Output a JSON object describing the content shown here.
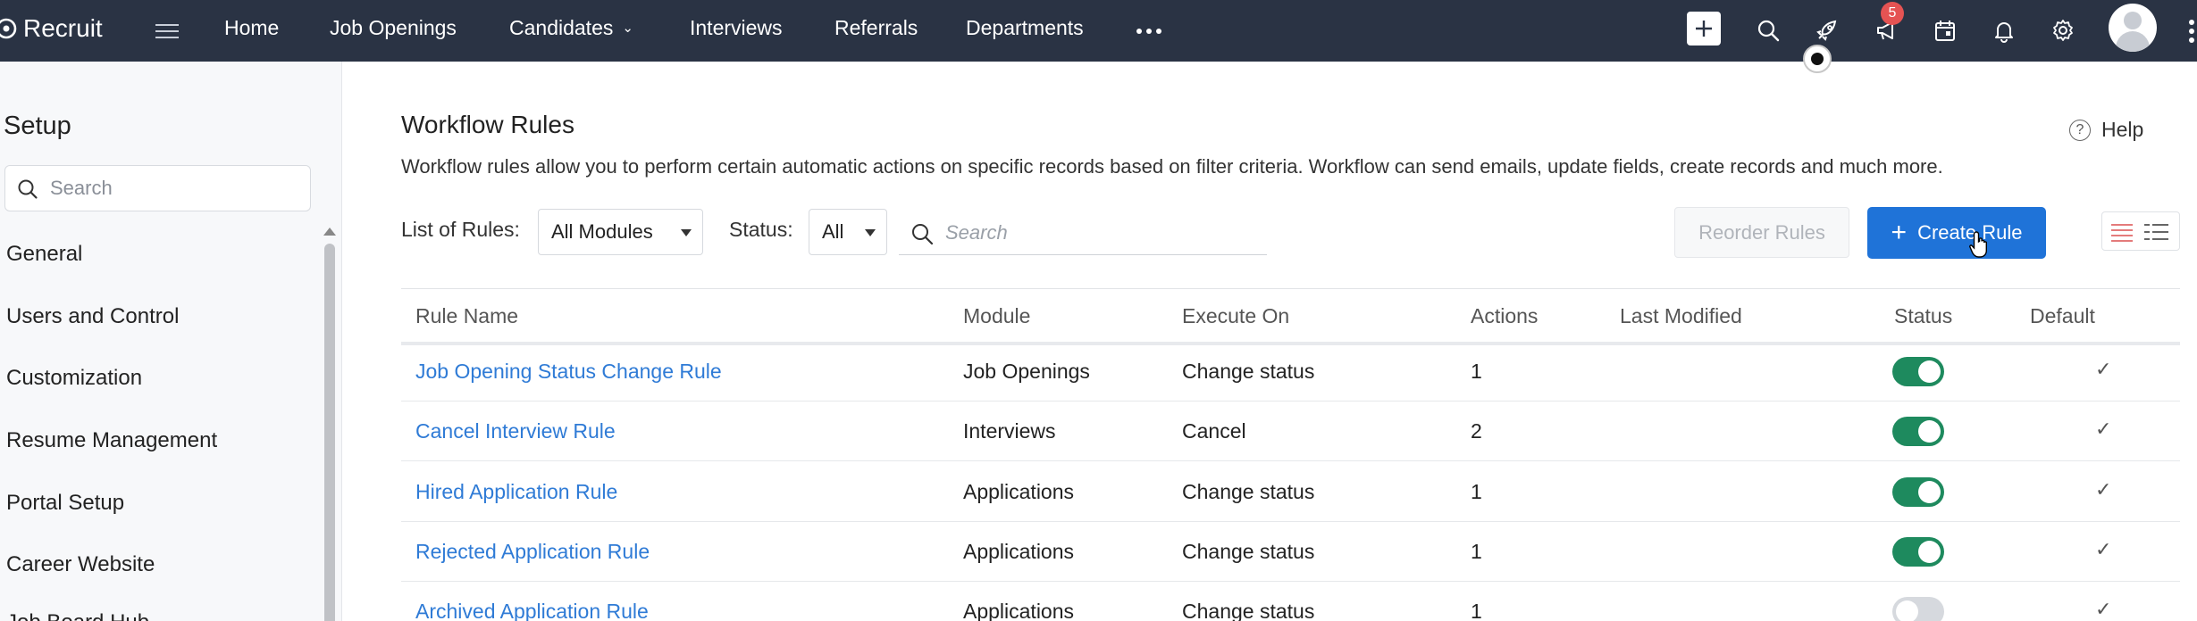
{
  "app": {
    "name": "Recruit",
    "nav": [
      "Home",
      "Job Openings",
      "Candidates",
      "Interviews",
      "Referrals",
      "Departments"
    ],
    "notification_count": "5",
    "icons": [
      "plus-icon",
      "search-icon",
      "rocket-icon",
      "announcement-icon",
      "calendar-icon",
      "bell-icon",
      "gear-icon",
      "more-icon"
    ]
  },
  "sidebar": {
    "title": "Setup",
    "search_placeholder": "Search",
    "items": [
      "General",
      "Users and Control",
      "Customization",
      "Resume Management",
      "Portal Setup",
      "Career Website",
      "Job Board Hub"
    ]
  },
  "main": {
    "title": "Workflow Rules",
    "help_label": "Help",
    "description": "Workflow rules allow you to perform certain automatic actions on specific records based on filter criteria. Workflow can send emails, update fields, create records and much more.",
    "list_label": "List of Rules:",
    "module_filter": "All Modules",
    "status_label": "Status:",
    "status_filter": "All",
    "search_placeholder": "Search",
    "reorder_label": "Reorder Rules",
    "create_label": "Create Rule",
    "colors": {
      "accent": "#1f73d8",
      "link": "#2f7bd6",
      "toggle_on": "#1e8a5e",
      "topbar": "#2a3344"
    }
  },
  "table": {
    "columns": [
      "Rule Name",
      "Module",
      "Execute On",
      "Actions",
      "Last Modified",
      "Status",
      "Default"
    ],
    "rows": [
      {
        "name": "Job Opening Status Change Rule",
        "module": "Job Openings",
        "execute_on": "Change status",
        "actions": "1",
        "last_modified": "",
        "status_on": true,
        "default": "✓"
      },
      {
        "name": "Cancel Interview Rule",
        "module": "Interviews",
        "execute_on": "Cancel",
        "actions": "2",
        "last_modified": "",
        "status_on": true,
        "default": "✓"
      },
      {
        "name": "Hired Application Rule",
        "module": "Applications",
        "execute_on": "Change status",
        "actions": "1",
        "last_modified": "",
        "status_on": true,
        "default": "✓"
      },
      {
        "name": "Rejected Application Rule",
        "module": "Applications",
        "execute_on": "Change status",
        "actions": "1",
        "last_modified": "",
        "status_on": true,
        "default": "✓"
      },
      {
        "name": "Archived Application Rule",
        "module": "Applications",
        "execute_on": "Change status",
        "actions": "1",
        "last_modified": "",
        "status_on": false,
        "default": "✓"
      }
    ]
  }
}
